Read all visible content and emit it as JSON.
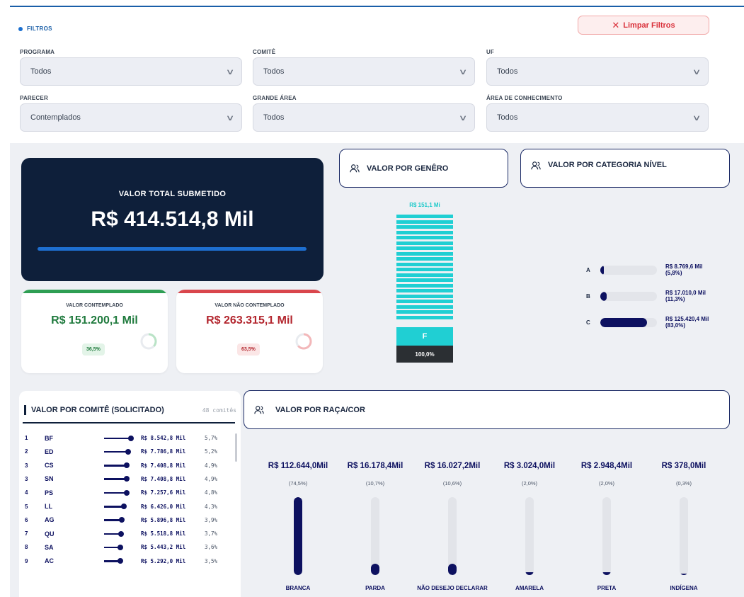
{
  "filters": {
    "header": "FILTROS",
    "clear_button": "Limpar Filtros",
    "programa": {
      "label": "PROGRAMA",
      "value": "Todos"
    },
    "comite": {
      "label": "COMITÊ",
      "value": "Todos"
    },
    "uf": {
      "label": "UF",
      "value": "Todos"
    },
    "parecer": {
      "label": "PARECER",
      "value": "Contemplados"
    },
    "grande_area": {
      "label": "GRANDE ÁREA",
      "value": "Todos"
    },
    "area_conhecimento": {
      "label": "ÁREA DE CONHECIMENTO",
      "value": "Todos"
    }
  },
  "total": {
    "title": "VALOR TOTAL SUBMETIDO",
    "value": "R$ 414.514,8 Mil"
  },
  "contemplado": {
    "title": "VALOR CONTEMPLADO",
    "value": "R$ 151.200,1 Mil",
    "pct_label": "36,5%",
    "pct": 36.5,
    "color": "#1f7a3d"
  },
  "nao_contemplado": {
    "title": "VALOR NÃO CONTEMPLADO",
    "value": "R$ 263.315,1 Mil",
    "pct_label": "63,5%",
    "pct": 63.5,
    "color": "#b3262e"
  },
  "genero": {
    "title": "VALOR POR GENÊRO",
    "top_label": "R$ 151,1 Mi",
    "bar_label": "F",
    "pct_label": "100,0%",
    "color": "#20cfd3"
  },
  "categoria": {
    "title": "VALOR POR CATEGORIA NÍVEL",
    "items": [
      {
        "letter": "A",
        "value": "R$ 8.769,6 Mil",
        "pct_label": "(5,8%)",
        "pct": 5.8
      },
      {
        "letter": "B",
        "value": "R$ 17.010,0 Mil",
        "pct_label": "(11,3%)",
        "pct": 11.3
      },
      {
        "letter": "C",
        "value": "R$ 125.420,4 Mil",
        "pct_label": "(83,0%)",
        "pct": 83.0
      }
    ]
  },
  "comite_table": {
    "title": "VALOR POR COMITÊ (SOLICITADO)",
    "count": "48 comitês",
    "rows": [
      {
        "rank": "1",
        "code": "BF",
        "value": "R$ 8.542,8 Mil",
        "pct_label": "5,7%",
        "pct": 5.7
      },
      {
        "rank": "2",
        "code": "ED",
        "value": "R$ 7.786,8 Mil",
        "pct_label": "5,2%",
        "pct": 5.2
      },
      {
        "rank": "3",
        "code": "CS",
        "value": "R$ 7.408,8 Mil",
        "pct_label": "4,9%",
        "pct": 4.9
      },
      {
        "rank": "3",
        "code": "SN",
        "value": "R$ 7.408,8 Mil",
        "pct_label": "4,9%",
        "pct": 4.9
      },
      {
        "rank": "4",
        "code": "PS",
        "value": "R$ 7.257,6 Mil",
        "pct_label": "4,8%",
        "pct": 4.8
      },
      {
        "rank": "5",
        "code": "LL",
        "value": "R$ 6.426,0 Mil",
        "pct_label": "4,3%",
        "pct": 4.3
      },
      {
        "rank": "6",
        "code": "AG",
        "value": "R$ 5.896,8 Mil",
        "pct_label": "3,9%",
        "pct": 3.9
      },
      {
        "rank": "7",
        "code": "QU",
        "value": "R$ 5.518,8 Mil",
        "pct_label": "3,7%",
        "pct": 3.7
      },
      {
        "rank": "8",
        "code": "SA",
        "value": "R$ 5.443,2 Mil",
        "pct_label": "3,6%",
        "pct": 3.6
      },
      {
        "rank": "9",
        "code": "AC",
        "value": "R$ 5.292,0 Mil",
        "pct_label": "3,5%",
        "pct": 3.5
      }
    ]
  },
  "raca": {
    "title": "VALOR POR RAÇA/COR",
    "items": [
      {
        "name": "BRANCA",
        "value": "R$ 112.644,0Mil",
        "pct_label": "(74,5%)",
        "pct": 74.5
      },
      {
        "name": "PARDA",
        "value": "R$ 16.178,4Mil",
        "pct_label": "(10,7%)",
        "pct": 10.7
      },
      {
        "name": "NÃO DESEJO DECLARAR",
        "value": "R$ 16.027,2Mil",
        "pct_label": "(10,6%)",
        "pct": 10.6
      },
      {
        "name": "AMARELA",
        "value": "R$ 3.024,0Mil",
        "pct_label": "(2,0%)",
        "pct": 2.0
      },
      {
        "name": "PRETA",
        "value": "R$ 2.948,4Mil",
        "pct_label": "(2,0%)",
        "pct": 2.0
      },
      {
        "name": "INDÍGENA",
        "value": "R$ 378,0Mil",
        "pct_label": "(0,3%)",
        "pct": 0.3
      }
    ]
  }
}
